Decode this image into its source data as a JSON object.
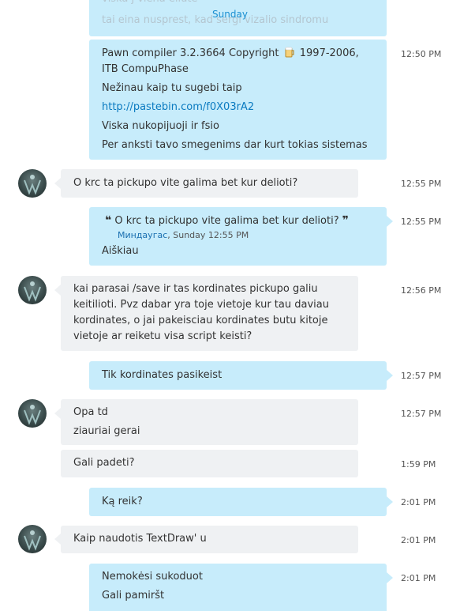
{
  "day_separator": "Sunday",
  "top_faded_lines": [
    "viska j viena eilute",
    "tai eina nusprest, kad sergi vizalio sindromu"
  ],
  "messages": [
    {
      "lines": [
        "Pawn compiler 3.2.3664      Copyright ",
        " 1997-2006,",
        "ITB CompuPhase",
        "Nežinau kaip tu sugebi taip",
        "http://pastebin.com/f0X03rA2",
        "Viska nukopijuoji ir fsio",
        "Per anksti tavo smegenims dar kurt tokias sistemas"
      ],
      "time": "12:50 PM"
    },
    {
      "text": "O krc ta pickupo vite galima bet kur delioti?",
      "time": "12:55 PM"
    },
    {
      "quote_text": "O krc ta pickupo vite galima bet kur delioti?",
      "quote_author": "Миндаугас",
      "quote_meta": ", Sunday 12:55 PM",
      "text": "Aiškiau",
      "time": "12:55 PM"
    },
    {
      "lines": [
        "kai parasai /save  ir tas kordinates pickupo galiu",
        "keitilioti. Pvz dabar yra toje vietoje kur tau daviau",
        "kordinates, o jai pakeisciau kordinates butu kitoje",
        "vietoje ar reiketu visa script keisti?"
      ],
      "time": "12:56 PM"
    },
    {
      "text": "Tik kordinates pasikeist",
      "time": "12:57 PM"
    },
    {
      "lines": [
        "Opa td",
        "ziauriai gerai"
      ],
      "time": "12:57 PM"
    },
    {
      "text": "Gali padeti?",
      "time": "1:59 PM"
    },
    {
      "text": "Ką reik?",
      "time": "2:01 PM"
    },
    {
      "text": "Kaip naudotis TextDraw' u",
      "time": "2:01 PM"
    },
    {
      "lines": [
        "Nemokėsi sukoduot",
        "Gali pamiršt"
      ],
      "time": "2:01 PM"
    }
  ],
  "colors": {
    "outgoing_bubble": "#c7ecfb",
    "incoming_bubble": "#eff1f3",
    "link": "#0a7ac0",
    "day_separator": "#1a8fd1"
  },
  "icons": {
    "avatar": "user-avatar-photo",
    "emoticon": "beer-emoticon"
  }
}
